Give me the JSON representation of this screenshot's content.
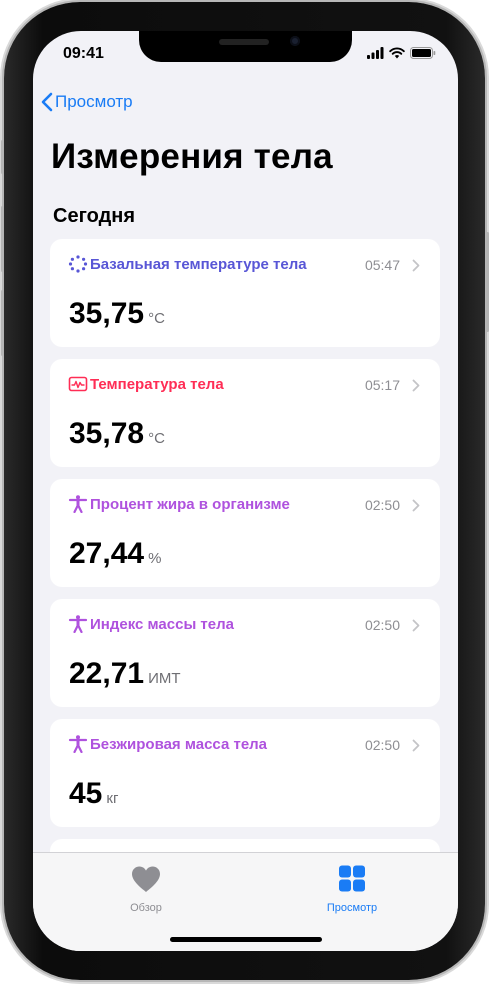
{
  "status": {
    "time": "09:41"
  },
  "nav": {
    "back_label": "Просмотр"
  },
  "page": {
    "title": "Измерения тела",
    "section": "Сегодня"
  },
  "cards": [
    {
      "label": "Базальная температуре тела",
      "time": "05:47",
      "value": "35,75",
      "unit": "°C",
      "icon": "dotted-circle-icon",
      "color": "#5856d6"
    },
    {
      "label": "Температура тела",
      "time": "05:17",
      "value": "35,78",
      "unit": "°C",
      "icon": "thermometer-graph-icon",
      "color": "#ff2d55"
    },
    {
      "label": "Процент жира в организме",
      "time": "02:50",
      "value": "27,44",
      "unit": "%",
      "icon": "body-figure-icon",
      "color": "#af52de"
    },
    {
      "label": "Индекс массы тела",
      "time": "02:50",
      "value": "22,71",
      "unit": "ИМТ",
      "icon": "body-figure-icon",
      "color": "#af52de"
    },
    {
      "label": "Безжировая масса тела",
      "time": "02:50",
      "value": "45",
      "unit": "кг",
      "icon": "body-figure-icon",
      "color": "#af52de"
    }
  ],
  "tabs": [
    {
      "label": "Обзор",
      "icon": "heart-icon",
      "active": false
    },
    {
      "label": "Просмотр",
      "icon": "grid-icon",
      "active": true
    }
  ],
  "colors": {
    "accent": "#1a7cf5",
    "inactive": "#8e8e93"
  }
}
